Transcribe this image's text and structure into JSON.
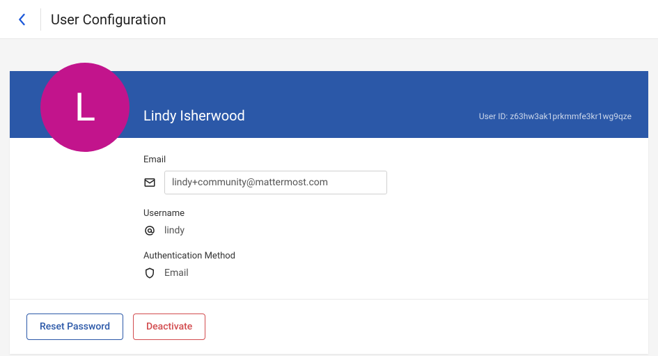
{
  "header": {
    "title": "User Configuration"
  },
  "user": {
    "display_name": "Lindy Isherwood",
    "avatar_initial": "L",
    "user_id_label": "User ID:",
    "user_id": "z63hw3ak1prkmmfe3kr1wg9qze"
  },
  "fields": {
    "email": {
      "label": "Email",
      "value": "lindy+community@mattermost.com"
    },
    "username": {
      "label": "Username",
      "value": "lindy"
    },
    "auth_method": {
      "label": "Authentication Method",
      "value": "Email"
    }
  },
  "actions": {
    "reset_password": "Reset Password",
    "deactivate": "Deactivate"
  }
}
